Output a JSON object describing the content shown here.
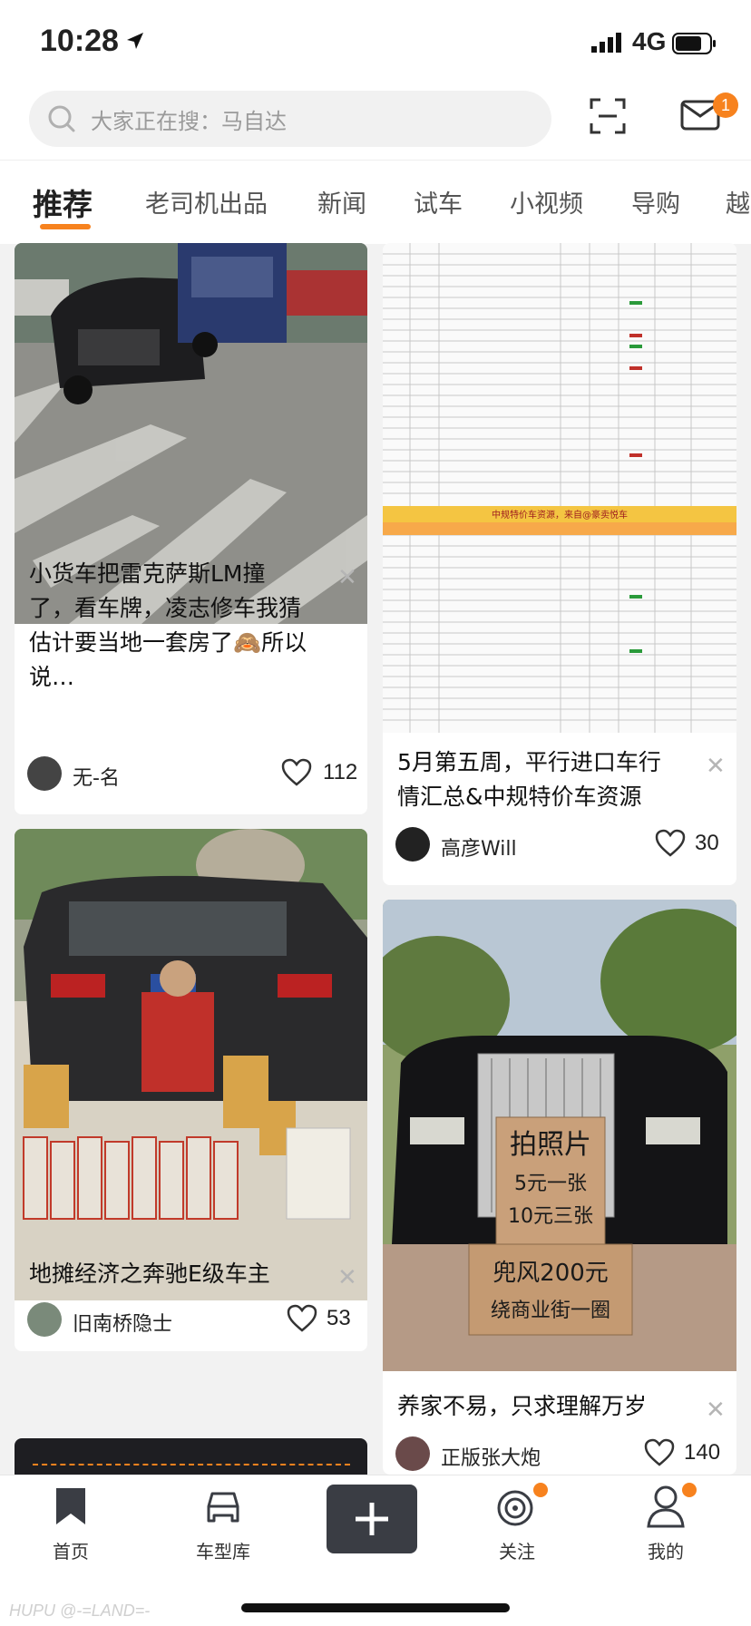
{
  "status": {
    "time": "10:28",
    "network": "4G"
  },
  "search": {
    "placeholder": "大家正在搜：马自达",
    "mail_badge": "1"
  },
  "tabs": [
    "推荐",
    "老司机出品",
    "新闻",
    "试车",
    "小视频",
    "导购",
    "越"
  ],
  "feed": {
    "left": [
      {
        "title": "小货车把雷克萨斯LM撞了，看车牌，凌志修车我猜估计要当地一套房了🙈所以说…",
        "author": "无-名",
        "likes": "112"
      },
      {
        "title": "地摊经济之奔驰E级车主",
        "author": "旧南桥隐士",
        "likes": "53"
      }
    ],
    "right": [
      {
        "title": "5月第五周，平行进口车行情汇总&中规特价车资源",
        "author": "高彦Will",
        "likes": "30"
      },
      {
        "title": "养家不易，只求理解万岁",
        "author": "正版张大炮",
        "likes": "140"
      }
    ]
  },
  "image_text": {
    "table_banner": "中规特价车资源，来自@豪卖悦车",
    "sign_lines": [
      "拍照片",
      "5元一张",
      "10元三张",
      "兜风200元",
      "绕商业街一圈"
    ]
  },
  "tabbar": [
    {
      "label": "首页",
      "icon": "home-bookmark-icon"
    },
    {
      "label": "车型库",
      "icon": "car-icon"
    },
    {
      "label": "",
      "icon": "plus-icon"
    },
    {
      "label": "关注",
      "icon": "target-icon"
    },
    {
      "label": "我的",
      "icon": "person-icon"
    }
  ],
  "watermark": "HUPU @-=LAND=-",
  "colors": {
    "accent": "#f7821e",
    "plus_button": "#3a3d44"
  }
}
